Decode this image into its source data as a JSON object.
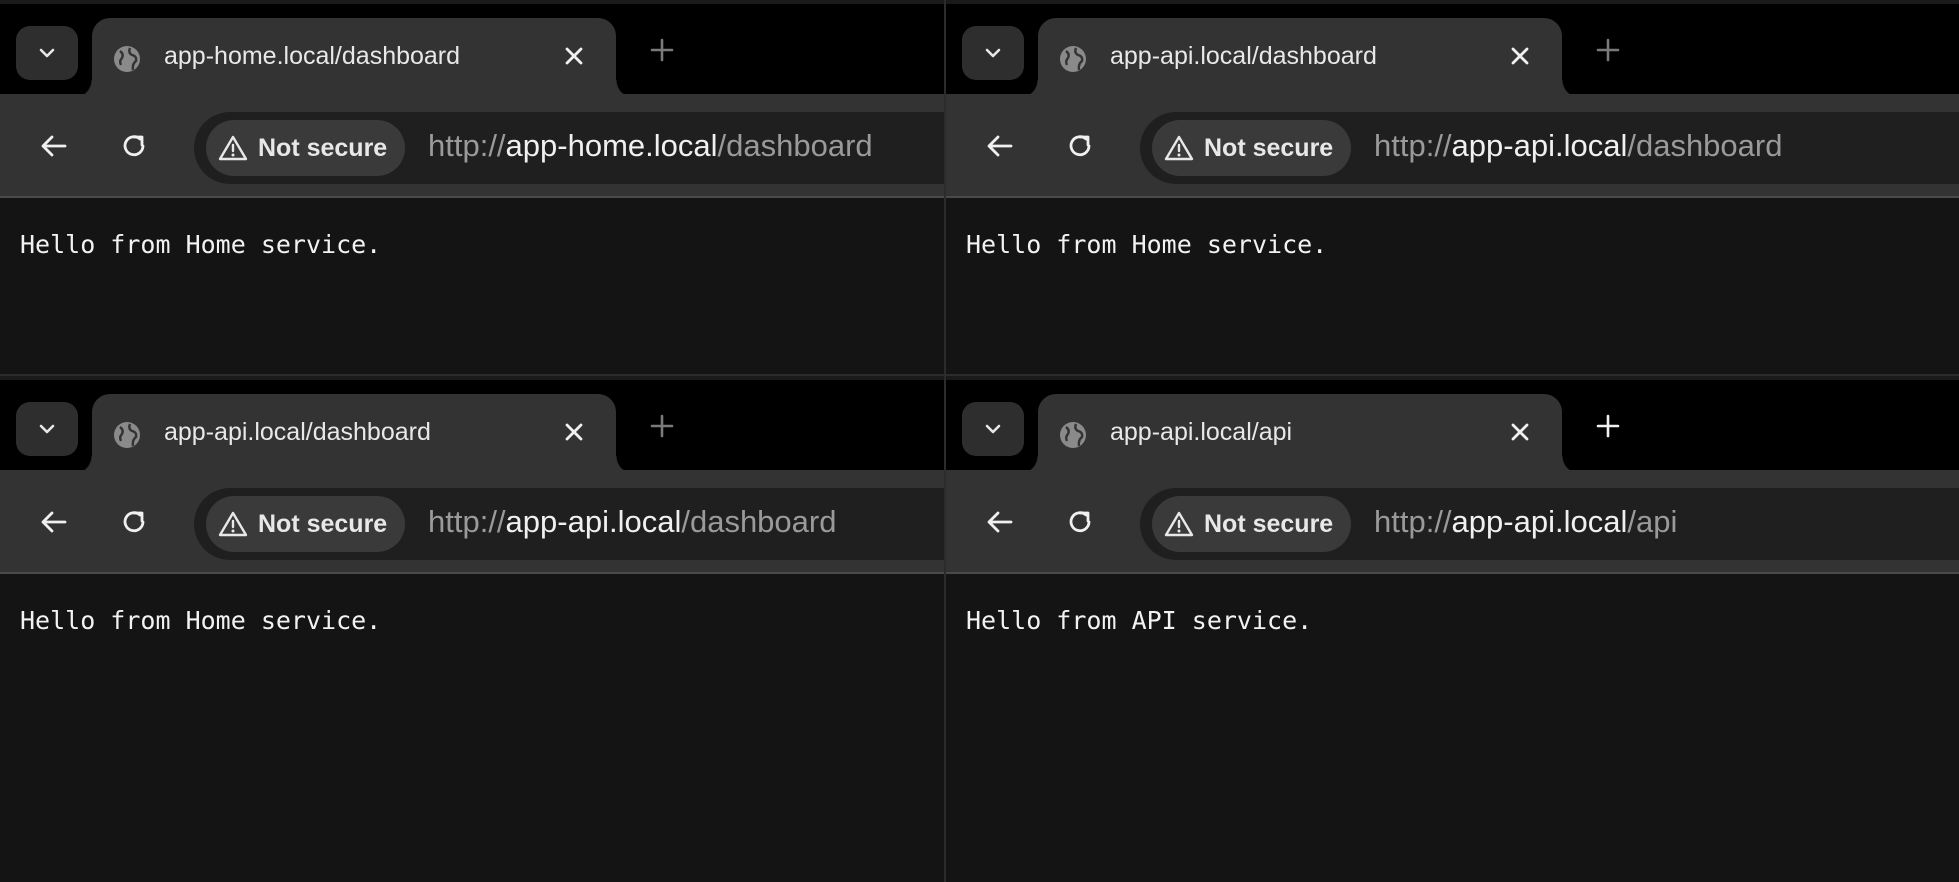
{
  "windows": [
    {
      "tab_title": "app-home.local/dashboard",
      "security_label": "Not secure",
      "url_scheme": "http://",
      "url_host": "app-home.local",
      "url_path": "/dashboard",
      "page_text": "Hello from Home service."
    },
    {
      "tab_title": "app-api.local/dashboard",
      "security_label": "Not secure",
      "url_scheme": "http://",
      "url_host": "app-api.local",
      "url_path": "/dashboard",
      "page_text": "Hello from Home service."
    },
    {
      "tab_title": "app-api.local/dashboard",
      "security_label": "Not secure",
      "url_scheme": "http://",
      "url_host": "app-api.local",
      "url_path": "/dashboard",
      "page_text": "Hello from Home service."
    },
    {
      "tab_title": "app-api.local/api",
      "security_label": "Not secure",
      "url_scheme": "http://",
      "url_host": "app-api.local",
      "url_path": "/api",
      "page_text": "Hello from API service."
    }
  ],
  "icons": {
    "tab_search": "chevron-down-icon",
    "tab_favicon": "globe-icon",
    "tab_close": "close-icon",
    "new_tab": "plus-icon",
    "back": "arrow-left-icon",
    "reload": "reload-icon",
    "security": "warning-triangle-icon"
  },
  "colors": {
    "tabstrip_bg": "#000000",
    "toolbar_bg": "#333333",
    "omnibox_bg": "#1f1f1f",
    "page_bg": "#141414",
    "text": "#f2f2f2",
    "url_dim": "#9a9a9a"
  }
}
